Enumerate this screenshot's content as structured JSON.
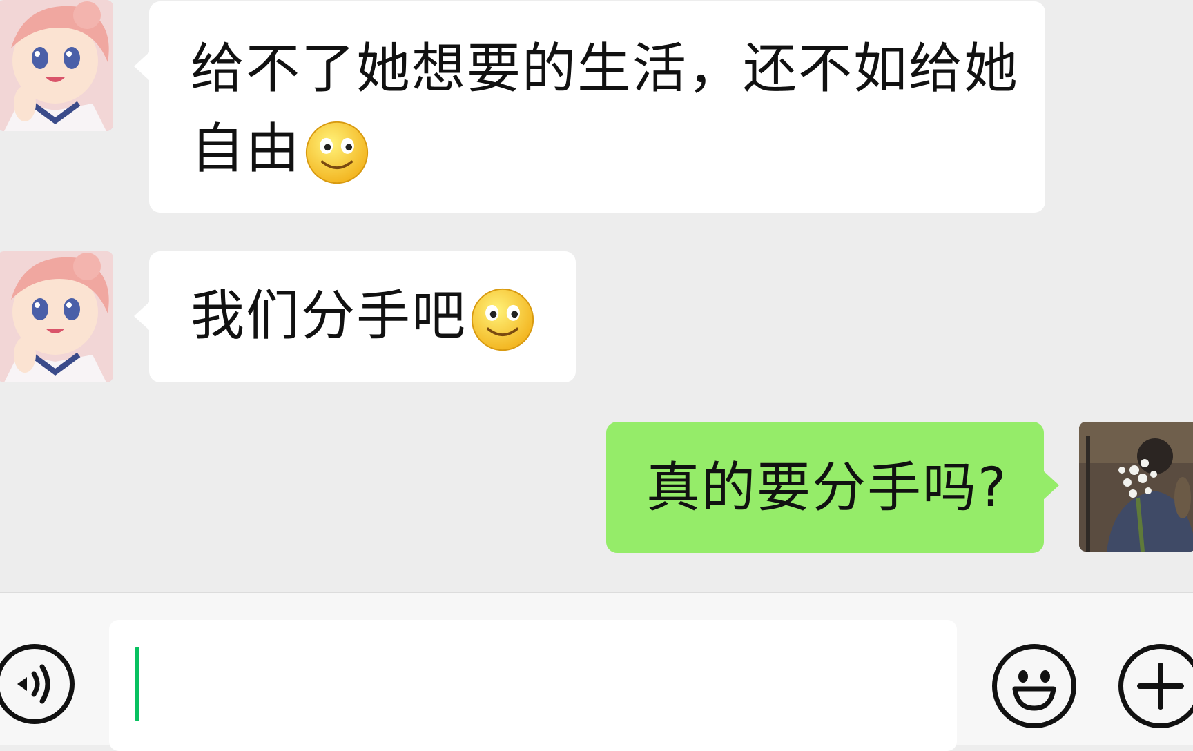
{
  "messages": [
    {
      "direction": "incoming",
      "text_line1": "给不了她想要的生活，还不如给她",
      "text_line2": "自由",
      "emoji": "smile-emoji"
    },
    {
      "direction": "incoming",
      "text": "我们分手吧",
      "emoji": "smile-emoji"
    },
    {
      "direction": "outgoing",
      "text": "真的要分手吗?"
    }
  ],
  "input": {
    "value": "",
    "placeholder": ""
  },
  "icons": {
    "voice": "voice-icon",
    "emoji": "emoji-face-icon",
    "more": "plus-icon"
  },
  "colors": {
    "outgoing_bubble": "#95ec69",
    "incoming_bubble": "#ffffff",
    "background": "#ededed",
    "caret": "#07c160"
  }
}
